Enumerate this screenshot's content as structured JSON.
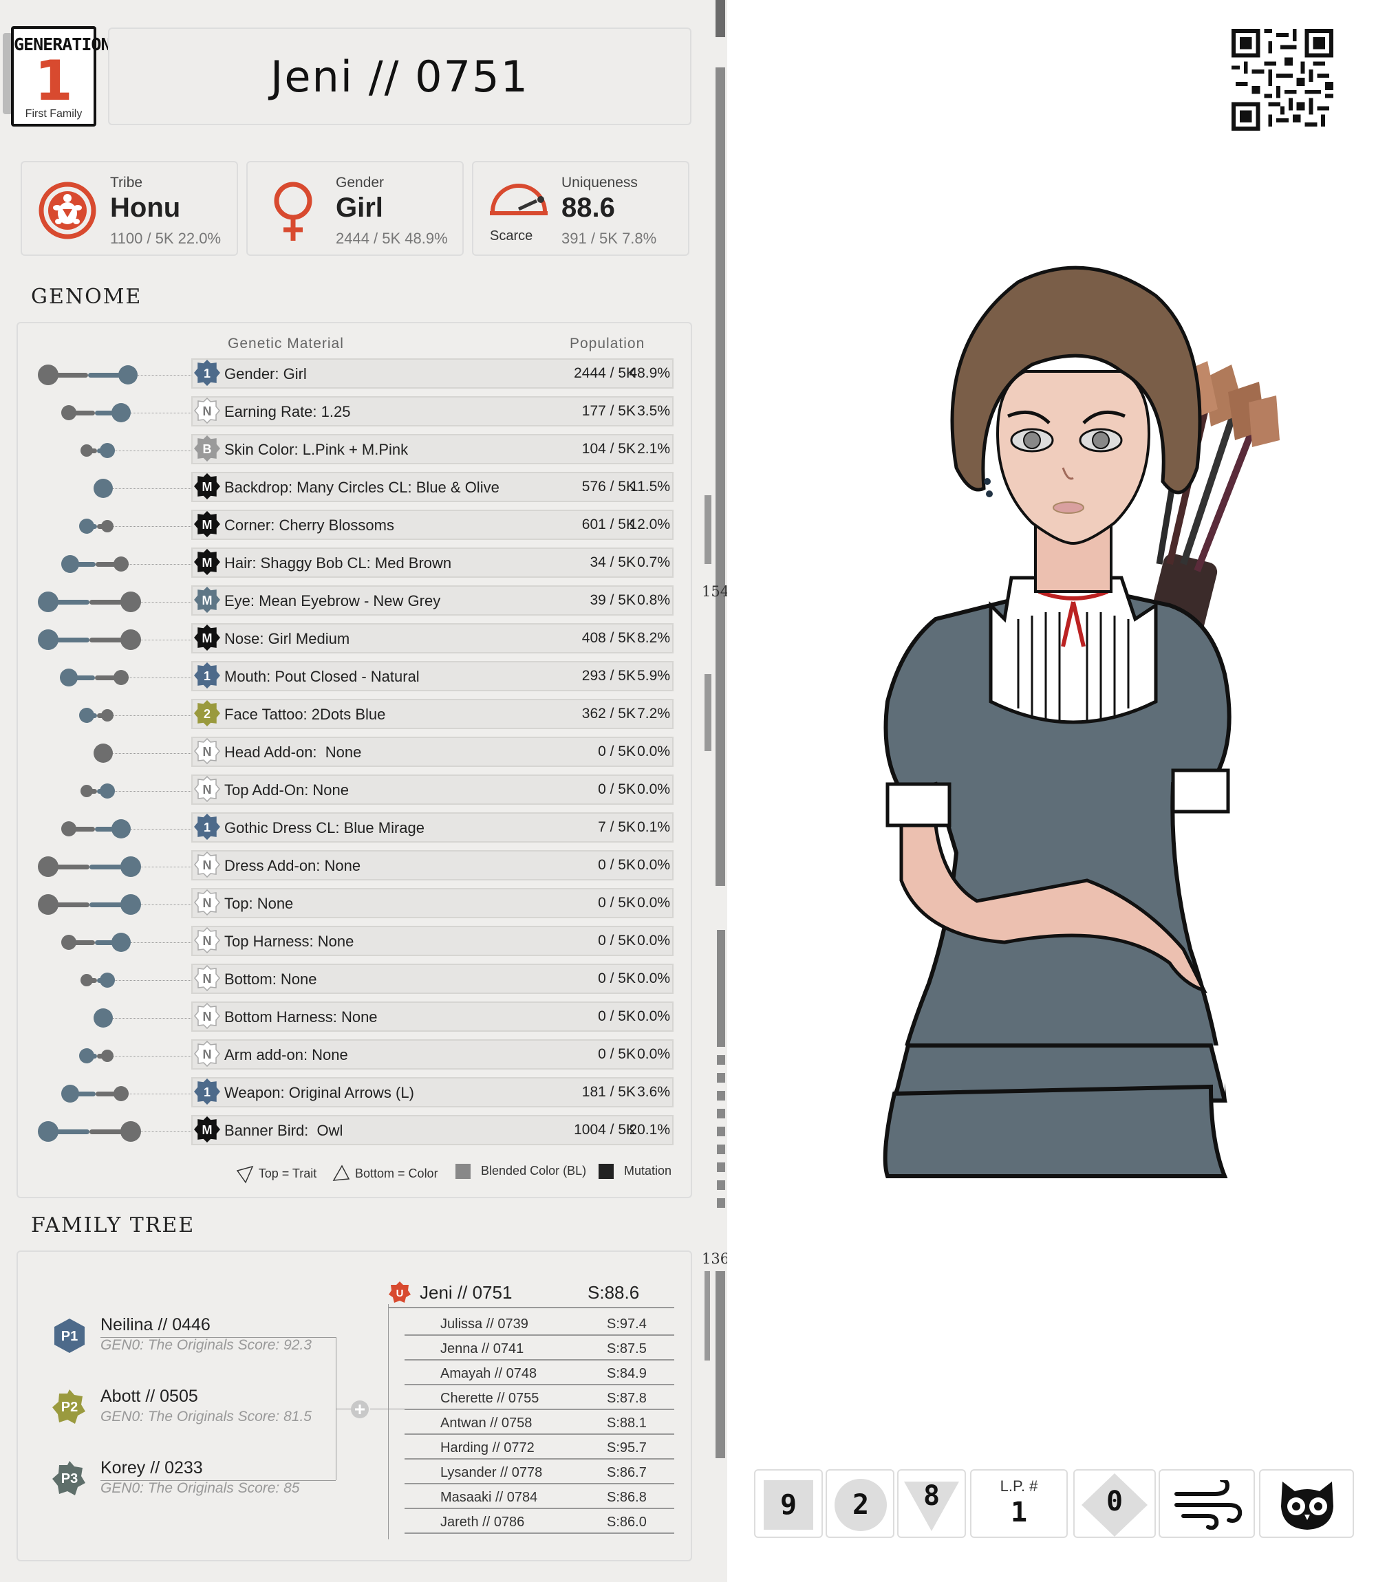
{
  "header": {
    "generation_label": "GENERATION",
    "generation_number": "1",
    "generation_family": "First Family",
    "character_name": "Jeni // 0751"
  },
  "stats": {
    "tribe": {
      "label": "Tribe",
      "value": "Honu",
      "sub": "1100 / 5K  22.0%"
    },
    "gender": {
      "label": "Gender",
      "value": "Girl",
      "sub": "2444 / 5K  48.9%"
    },
    "uniqueness": {
      "label": "Uniqueness",
      "value": "88.6",
      "sub": "391 / 5K  7.8%",
      "tier": "Scarce"
    }
  },
  "genome": {
    "title": "GENOME",
    "col_material": "Genetic Material",
    "col_population": "Population",
    "rows": [
      {
        "badge": "1",
        "badge_type": "blue",
        "name": "Gender: Girl",
        "count": "2444 / 5K",
        "pct": "48.9%"
      },
      {
        "badge": "N",
        "badge_type": "none",
        "name": "Earning Rate: 1.25",
        "count": "177 / 5K",
        "pct": "3.5%"
      },
      {
        "badge": "B",
        "badge_type": "grey",
        "name": "Skin Color: L.Pink + M.Pink",
        "count": "104 / 5K",
        "pct": "2.1%"
      },
      {
        "badge": "M",
        "badge_type": "mix",
        "name": "Backdrop: Many Circles CL: Blue & Olive",
        "count": "576 / 5K",
        "pct": "11.5%"
      },
      {
        "badge": "M",
        "badge_type": "black",
        "name": "Corner: Cherry Blossoms",
        "count": "601 / 5K",
        "pct": "12.0%"
      },
      {
        "badge": "M",
        "badge_type": "mix",
        "name": "Hair: Shaggy Bob CL: Med Brown",
        "count": "34 / 5K",
        "pct": "0.7%"
      },
      {
        "badge": "M",
        "badge_type": "mixblue",
        "name": "Eye: Mean Eyebrow - New Grey",
        "count": "39 / 5K",
        "pct": "0.8%"
      },
      {
        "badge": "M",
        "badge_type": "black",
        "name": "Nose: Girl Medium",
        "count": "408 / 5K",
        "pct": "8.2%"
      },
      {
        "badge": "1",
        "badge_type": "blue",
        "name": "Mouth: Pout Closed - Natural",
        "count": "293 / 5K",
        "pct": "5.9%"
      },
      {
        "badge": "2",
        "badge_type": "olive",
        "name": "Face Tattoo: 2Dots Blue",
        "count": "362 / 5K",
        "pct": "7.2%"
      },
      {
        "badge": "N",
        "badge_type": "none",
        "name": "Head Add-on:  None",
        "count": "0 / 5K",
        "pct": "0.0%"
      },
      {
        "badge": "N",
        "badge_type": "none",
        "name": "Top Add-On: None",
        "count": "0 / 5K",
        "pct": "0.0%"
      },
      {
        "badge": "1",
        "badge_type": "blueolive",
        "name": "Gothic Dress CL: Blue Mirage",
        "count": "7 / 5K",
        "pct": "0.1%"
      },
      {
        "badge": "N",
        "badge_type": "none",
        "name": "Dress Add-on: None",
        "count": "0 / 5K",
        "pct": "0.0%"
      },
      {
        "badge": "N",
        "badge_type": "none",
        "name": "Top: None",
        "count": "0 / 5K",
        "pct": "0.0%"
      },
      {
        "badge": "N",
        "badge_type": "none",
        "name": "Top Harness: None",
        "count": "0 / 5K",
        "pct": "0.0%"
      },
      {
        "badge": "N",
        "badge_type": "none",
        "name": "Bottom: None",
        "count": "0 / 5K",
        "pct": "0.0%"
      },
      {
        "badge": "N",
        "badge_type": "none",
        "name": "Bottom Harness: None",
        "count": "0 / 5K",
        "pct": "0.0%"
      },
      {
        "badge": "N",
        "badge_type": "none",
        "name": "Arm add-on: None",
        "count": "0 / 5K",
        "pct": "0.0%"
      },
      {
        "badge": "1",
        "badge_type": "blue",
        "name": "Weapon: Original Arrows (L)",
        "count": "181 / 5K",
        "pct": "3.6%"
      },
      {
        "badge": "M",
        "badge_type": "black",
        "name": "Banner Bird:  Owl",
        "count": "1004 / 5K",
        "pct": "20.1%"
      }
    ],
    "legend": {
      "top": "Top = Trait",
      "bottom": "Bottom = Color",
      "blended": "Blended Color (BL)",
      "mutation": "Mutation"
    }
  },
  "family": {
    "title": "FAMILY TREE",
    "parents": [
      {
        "tag": "P1",
        "name": "Neilina  //  0446",
        "score": "GEN0: The Originals Score: 92.3",
        "color": "#4d6a8a"
      },
      {
        "tag": "P2",
        "name": "Abott  //  0505",
        "score": "GEN0: The Originals Score: 81.5",
        "color": "#9a9a3e"
      },
      {
        "tag": "P3",
        "name": "Korey  //  0233",
        "score": "GEN0: The Originals Score: 85",
        "color": "#5e6e6a"
      }
    ],
    "self": {
      "tag": "U",
      "name": "Jeni // 0751",
      "score": "S:88.6"
    },
    "siblings": [
      {
        "name": "Julissa  //  0739",
        "score": "S:97.4"
      },
      {
        "name": "Jenna  //  0741",
        "score": "S:87.5"
      },
      {
        "name": "Amayah  //  0748",
        "score": "S:84.9"
      },
      {
        "name": "Cherette  //  0755",
        "score": "S:87.8"
      },
      {
        "name": "Antwan  //  0758",
        "score": "S:88.1"
      },
      {
        "name": "Harding  //  0772",
        "score": "S:95.7"
      },
      {
        "name": "Lysander  //  0778",
        "score": "S:86.7"
      },
      {
        "name": "Masaaki  //  0784",
        "score": "S:86.8"
      },
      {
        "name": "Jareth  //  0786",
        "score": "S:86.0"
      }
    ]
  },
  "sidebar": {
    "upper_count": "154",
    "lower_count": "136"
  },
  "tiles": {
    "square_value": "9",
    "circle_value": "2",
    "triangle_value": "8",
    "lp_label": "L.P. #",
    "lp_value": "1",
    "diamond_value": "0",
    "wind_icon": "wind-icon",
    "owl_icon": "owl-icon"
  },
  "colors": {
    "accent_red": "#d84a2f",
    "steel_blue": "#5e7686",
    "dress": "#5f6e78"
  }
}
